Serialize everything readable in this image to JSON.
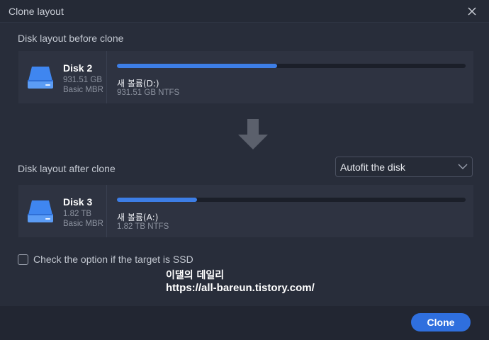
{
  "window": {
    "title": "Clone layout"
  },
  "before": {
    "section_label": "Disk layout before clone",
    "disk_name": "Disk 2",
    "disk_size": "931.51 GB",
    "disk_type": "Basic MBR",
    "partition_name": "새 볼륨(D:)",
    "partition_info": "931.51 GB NTFS",
    "used_fraction": 0.46
  },
  "after": {
    "section_label": "Disk layout after clone",
    "layout_option": "Autofit the disk",
    "disk_name": "Disk 3",
    "disk_size": "1.82 TB",
    "disk_type": "Basic MBR",
    "partition_name": "새 볼륨(A:)",
    "partition_info": "1.82 TB NTFS",
    "used_fraction": 0.23
  },
  "ssd_option": {
    "label": "Check the option if the target is SSD",
    "checked": false
  },
  "watermark": {
    "line1": "이댈의 데일리",
    "line2": "https://all-bareun.tistory.com/"
  },
  "footer": {
    "clone_label": "Clone"
  },
  "colors": {
    "accent": "#2f6fde",
    "bar_fill": "#3d7ee6",
    "disk_icon": "#3f86f0"
  },
  "icons": [
    "close-icon",
    "disk-icon",
    "arrow-down-icon",
    "chevron-down-icon"
  ]
}
